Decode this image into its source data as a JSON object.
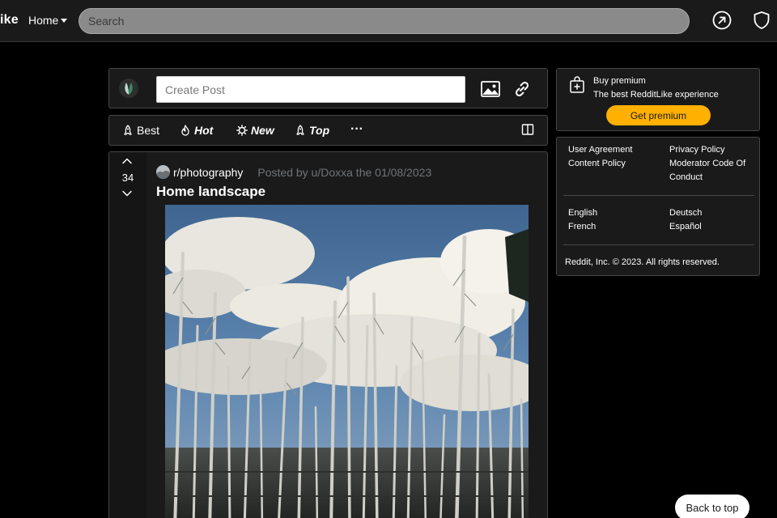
{
  "header": {
    "brand": "ike",
    "home_label": "Home",
    "search_placeholder": "Search"
  },
  "create_post": {
    "placeholder": "Create Post"
  },
  "sort": {
    "items": [
      {
        "label": "Best",
        "icon": "rocket-icon"
      },
      {
        "label": "Hot",
        "icon": "flame-icon"
      },
      {
        "label": "New",
        "icon": "sun-icon"
      },
      {
        "label": "Top",
        "icon": "rocket-icon"
      }
    ],
    "more_label": "···"
  },
  "post": {
    "votes": "34",
    "subreddit": "r/photography",
    "posted_by": "Posted by u/Doxxa the 01/08/2023",
    "title": "Home landscape"
  },
  "premium": {
    "title": "Buy premium",
    "subtitle": "The best RedditLike experience",
    "button": "Get premium",
    "accent_color": "#ffb000"
  },
  "footer_links": {
    "col1": [
      "User Agreement",
      "Content Policy"
    ],
    "col2": [
      "Privacy Policy",
      "Moderator Code Of",
      "Conduct"
    ],
    "lang_col1": [
      "English",
      "French"
    ],
    "lang_col2": [
      "Deutsch",
      "Español"
    ],
    "copyright": "Reddit, Inc. © 2023. All rights reserved."
  },
  "back_to_top": "Back to top"
}
